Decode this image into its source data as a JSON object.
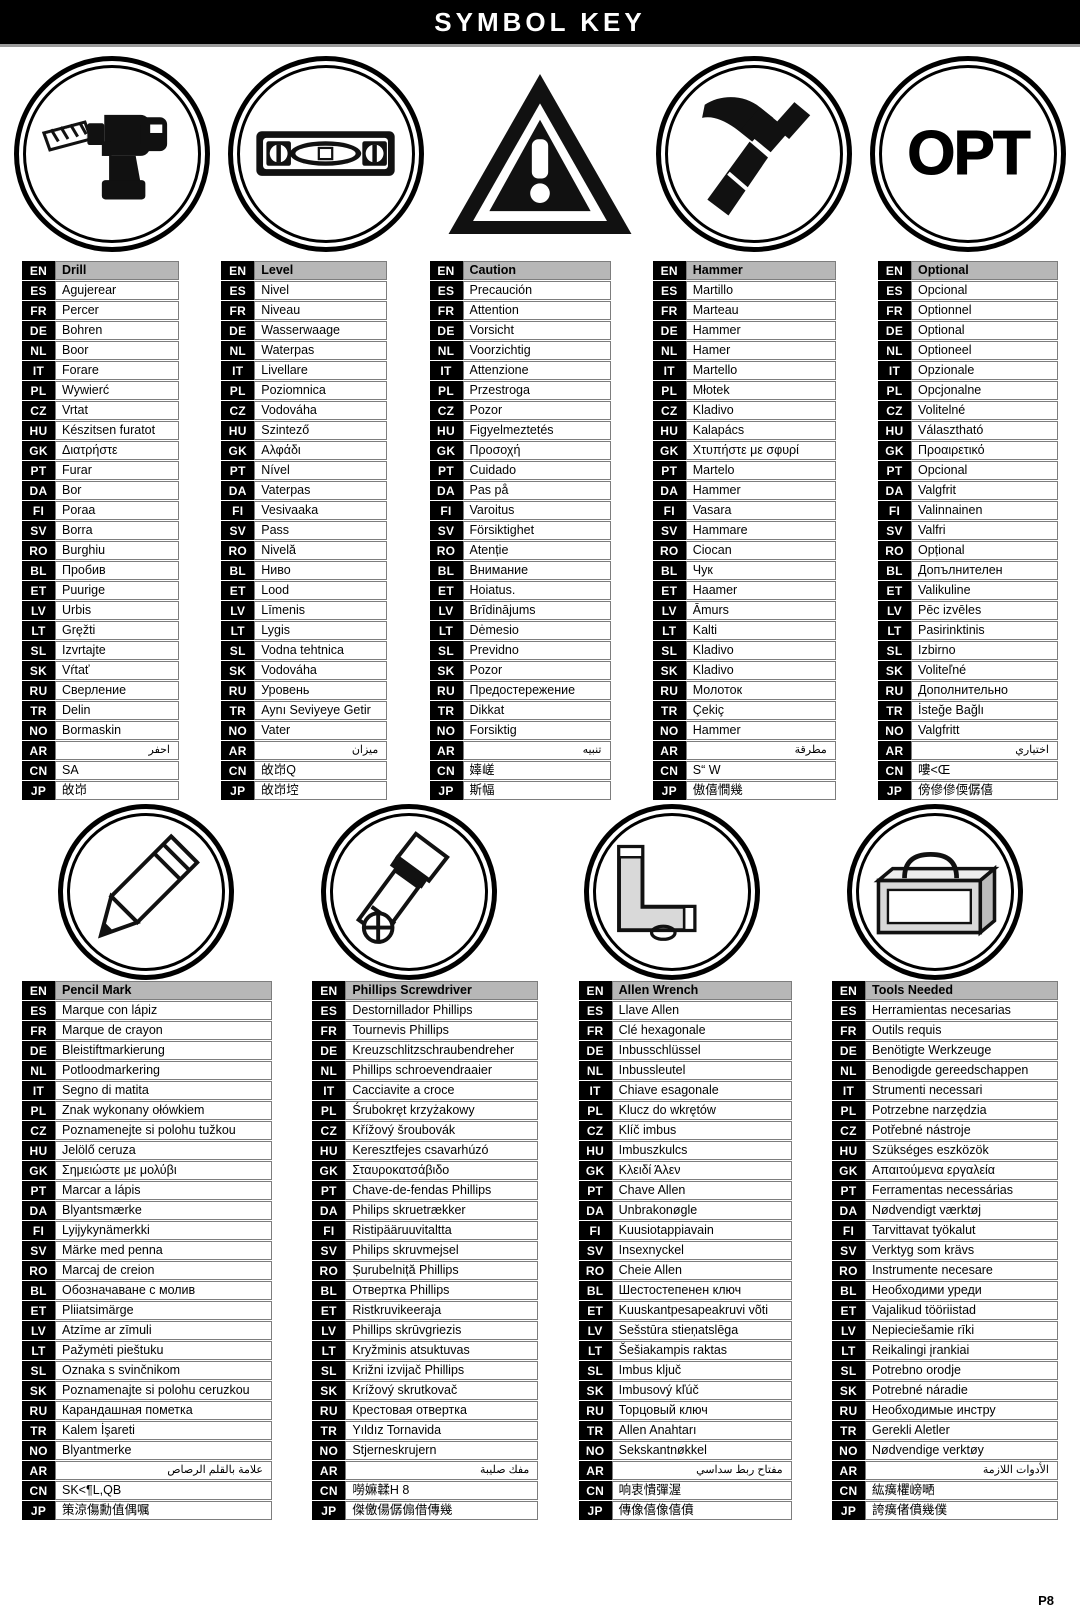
{
  "header": {
    "title": "SYMBOL KEY"
  },
  "footer": {
    "page": "P8"
  },
  "colors": {
    "header_bg": "#000000",
    "header_text": "#ffffff",
    "lang_bg": "#000000",
    "head_row_bg": "#b7b7b7",
    "cell_border": "#7d7d7d"
  },
  "icons": {
    "top": [
      {
        "name": "drill-icon",
        "label": "drill"
      },
      {
        "name": "level-icon",
        "label": "level"
      },
      {
        "name": "caution-triangle-icon",
        "label": "caution"
      },
      {
        "name": "hammer-icon",
        "label": "hammer"
      },
      {
        "name": "optional-opt-icon",
        "label": "OPT"
      }
    ],
    "bottom": [
      {
        "name": "pencil-icon",
        "label": "pencil mark"
      },
      {
        "name": "phillips-screwdriver-icon",
        "label": "phillips screwdriver"
      },
      {
        "name": "allen-wrench-icon",
        "label": "allen wrench"
      },
      {
        "name": "toolbox-icon",
        "label": "tools needed"
      }
    ]
  },
  "lang_codes": [
    "EN",
    "ES",
    "FR",
    "DE",
    "NL",
    "IT",
    "PL",
    "CZ",
    "HU",
    "GK",
    "PT",
    "DA",
    "FI",
    "SV",
    "RO",
    "BL",
    "ET",
    "LV",
    "LT",
    "SL",
    "SK",
    "RU",
    "TR",
    "NO",
    "AR",
    "CN",
    "JP"
  ],
  "tables": {
    "drill": {
      "id": "drill",
      "terms": [
        "Drill",
        "Agujerear",
        "Percer",
        "Bohren",
        "Boor",
        "Forare",
        "Wywierć",
        "Vrtat",
        "Készitsen furatot",
        "Διατρήστε",
        "Furar",
        "Bor",
        "Poraa",
        "Borra",
        "Burghiu",
        "Пробив",
        "Puurige",
        "Urbis",
        "Gręžti",
        "Izvrtajte",
        "Vŕtať",
        "Сверление",
        "Delin",
        "Bormaskin",
        "احفر",
        "SA",
        "敀岇"
      ]
    },
    "level": {
      "id": "level",
      "terms": [
        "Level",
        "Nivel",
        "Niveau",
        "Wasserwaage",
        "Waterpas",
        "Livellare",
        "Poziomnica",
        "Vodováha",
        "Szintező",
        "Αλφάδι",
        "Nível",
        "Vaterpas",
        "Vesivaaka",
        "Pass",
        "Nivelă",
        "Ниво",
        "Lood",
        "Līmenis",
        "Lygis",
        "Vodna tehtnica",
        "Vodováha",
        "Уровень",
        "Aynı Seviyeye Getir",
        "Vater",
        "ميزان",
        "敀岇Q",
        "敀岇埪"
      ]
    },
    "caution": {
      "id": "caution",
      "terms": [
        "Caution",
        "Precaución",
        "Attention",
        "Vorsicht",
        "Voorzichtig",
        "Attenzione",
        "Przestroga",
        "Pozor",
        "Figyelmeztetés",
        "Προσοχή",
        "Cuidado",
        "Pas på",
        "Varoitus",
        "Försiktighet",
        "Atenție",
        "Внимание",
        "Hoiatus.",
        "Brīdinājums",
        "Dėmesio",
        "Previdno",
        "Pozor",
        "Предостережение",
        "Dikkat",
        "Forsiktig",
        "تنبيه",
        "嫴嵯",
        "斯幅"
      ]
    },
    "hammer": {
      "id": "hammer",
      "terms": [
        "Hammer",
        "Martillo",
        "Marteau",
        "Hammer",
        "Hamer",
        "Martello",
        "Młotek",
        "Kladivo",
        "Kalapács",
        "Χτυπήστε με σφυρί",
        "Martelo",
        "Hammer",
        "Vasara",
        "Hammare",
        "Ciocan",
        "Чук",
        "Haamer",
        "Āmurs",
        "Kalti",
        "Kladivo",
        "Kladivo",
        "Молоток",
        "Çekiç",
        "Hammer",
        "مطرقة",
        "S“ W",
        "傲僖憪幾"
      ]
    },
    "optional": {
      "id": "optional",
      "terms": [
        "Optional",
        "Opcional",
        "Optionnel",
        "Optional",
        "Optioneel",
        "Opzionale",
        "Opcjonalne",
        "Volitelné",
        "Választható",
        "Προαιρετικό",
        "Opcional",
        "Valgfrit",
        "Valinnainen",
        "Valfri",
        "Opțional",
        "Допълнителен",
        "Valikuline",
        "Pēc izvēles",
        "Pasirinktinis",
        "Izbirno",
        "Voliteľné",
        "Дополнительно",
        "İsteğe Bağlı",
        "Valgfritt",
        "اختياري",
        "嘍<Œ",
        "傍傪傪偄僝僖"
      ]
    },
    "pencil_mark": {
      "id": "pencil-mark",
      "terms": [
        "Pencil Mark",
        "Marque con lápiz",
        "Marque de crayon",
        "Bleistiftmarkierung",
        "Potloodmarkering",
        "Segno di matita",
        "Znak wykonany ołówkiem",
        "Poznamenejte si polohu tužkou",
        "Jelölő ceruza",
        "Σημειώστε με μολύβι",
        "Marcar a lápis",
        "Blyantsmærke",
        "Lyijykynämerkki",
        "Märke med penna",
        "Marcaj de creion",
        "Обозначаване с молив",
        "Pliiatsimärge",
        "Atzīme ar zīmuli",
        "Pažymėti pieštuku",
        "Oznaka s svinčnikom",
        "Poznamenajte si polohu ceruzkou",
        "Карандашная пометка",
        "Kalem İşareti",
        "Blyantmerke",
        "علامة بالقلم الرصاص",
        "SK<¶L,QB",
        "策涼傷勳值偶嘱"
      ]
    },
    "phillips_screwdriver": {
      "id": "phillips-screwdriver",
      "terms": [
        "Phillips Screwdriver",
        "Destornillador Phillips",
        "Tournevis Phillips",
        "Kreuzschlitzschraubendreher",
        "Phillips schroevendraaier",
        "Cacciavite a croce",
        "Śrubokręt krzyżakowy",
        "Křížový šroubovák",
        "Keresztfejes csavarhúzó",
        "Σταυροκατσάβιδο",
        "Chave-de-fendas Phillips",
        "Philips skruetrækker",
        "Ristipääruuvitaltta",
        "Philips skruvmejsel",
        "Șurubelniță Phillips",
        "Отвертка Phillips",
        "Ristkruvikeeraja",
        "Phillips skrūvgriezis",
        "Kryžminis atsuktuvas",
        "Križni izvijač Phillips",
        "Krížový skrutkovač",
        "Крестовая отвертка",
        "Yıldız Tornavida",
        "Stjerneskrujern",
        "مفك صليبة",
        "嘮嫲韖H 8",
        "傑儌偒僝傓借傳幾"
      ]
    },
    "allen_wrench": {
      "id": "allen-wrench",
      "terms": [
        "Allen Wrench",
        "Llave Allen",
        "Clé hexagonale",
        "Inbusschlüssel",
        "Inbussleutel",
        "Chiave esagonale",
        "Klucz do wkrętów",
        "Klíč imbus",
        "Imbuszkulcs",
        "Κλειδί Άλεν",
        "Chave Allen",
        "Unbrakonøgle",
        "Kuusiotappiavain",
        "Insexnyckel",
        "Cheie Allen",
        "Шестостепенен ключ",
        "Kuuskantpesapeakruvi võti",
        "Sešstūra stieņatslēga",
        "Šešiakampis raktas",
        "Imbus ključ",
        "Imbusový kľúč",
        "Торцовый ключ",
        "Allen Anahtarı",
        "Sekskantnøkkel",
        "مفتاح ربط سداسي",
        "响衷憒彈渥",
        "傳像僖像僖僨"
      ]
    },
    "tools_needed": {
      "id": "tools-needed",
      "terms": [
        "Tools Needed",
        "Herramientas necesarias",
        "Outils requis",
        "Benötigte Werkzeuge",
        "Benodigde gereedschappen",
        "Strumenti necessari",
        "Potrzebne narzędzia",
        "Potřebné nástroje",
        "Szükséges eszközök",
        "Απαιτούμενα εργαλεία",
        "Ferramentas necessárias",
        "Nødvendigt værktøj",
        "Tarvittavat työkalut",
        "Verktyg som krävs",
        "Instrumente necesare",
        "Необходими уреди",
        "Vajalikud tööriistad",
        "Nepieciešamie rīki",
        "Reikalingi įrankiai",
        "Potrebno orodje",
        "Potrebné náradie",
        "Необходимые инстру",
        "Gerekli Aletler",
        "Nødvendige verktøy",
        "الأدوات اللازمة",
        "紘癀欋嵭嗮",
        "誇癀偖僨幾僕"
      ]
    }
  }
}
